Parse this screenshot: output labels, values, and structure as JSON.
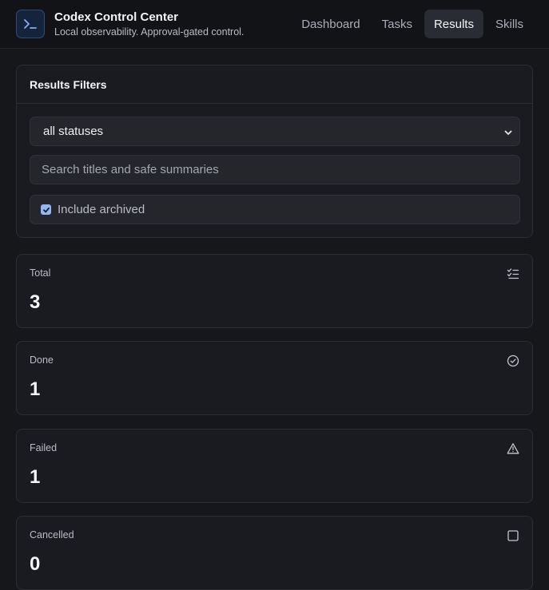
{
  "header": {
    "title": "Codex Control Center",
    "subtitle": "Local observability. Approval-gated control.",
    "logo_icon": "terminal-icon"
  },
  "nav": {
    "tabs": [
      {
        "label": "Dashboard",
        "active": false
      },
      {
        "label": "Tasks",
        "active": false
      },
      {
        "label": "Results",
        "active": true
      },
      {
        "label": "Skills",
        "active": false
      }
    ]
  },
  "filters": {
    "title": "Results Filters",
    "status_select": {
      "value": "all statuses"
    },
    "search": {
      "value": "",
      "placeholder": "Search titles and safe summaries"
    },
    "include_archived": {
      "label": "Include archived",
      "checked": true
    }
  },
  "stats": [
    {
      "label": "Total",
      "value": "3",
      "icon": "list-checks-icon"
    },
    {
      "label": "Done",
      "value": "1",
      "icon": "check-circle-icon"
    },
    {
      "label": "Failed",
      "value": "1",
      "icon": "warning-triangle-icon"
    },
    {
      "label": "Cancelled",
      "value": "0",
      "icon": "square-icon"
    }
  ],
  "colors": {
    "background": "#16171b",
    "panel": "#1a1b20",
    "accent": "#8fb8f5"
  }
}
